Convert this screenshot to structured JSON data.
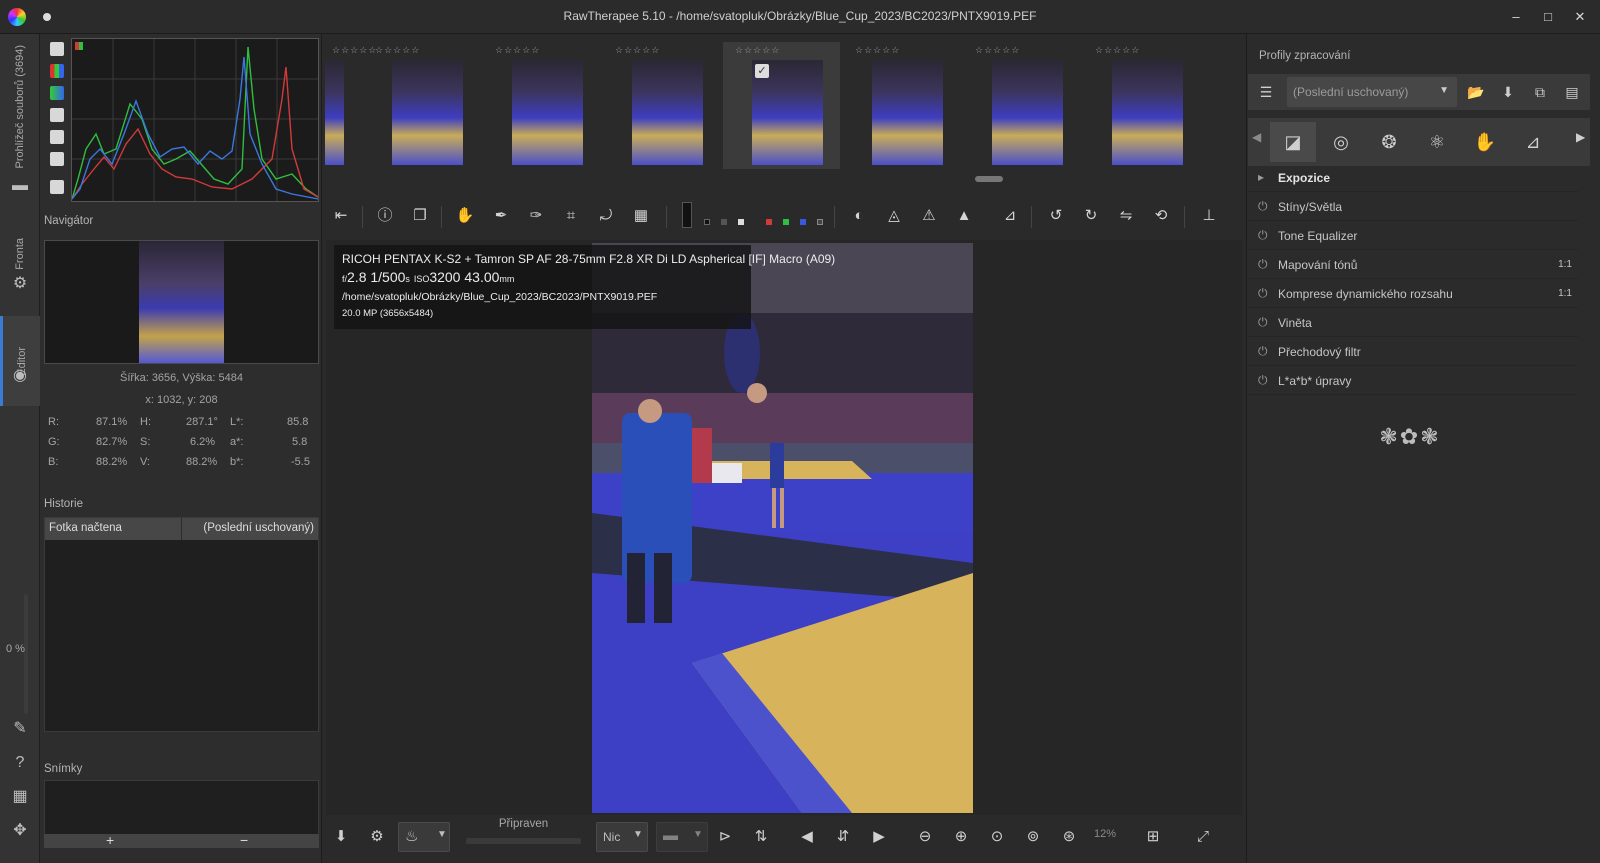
{
  "window": {
    "title": "RawTherapee 5.10 - /home/svatopluk/Obrázky/Blue_Cup_2023/BC2023/PNTX9019.PEF",
    "minimize": "–",
    "maximize": "□",
    "close": "✕"
  },
  "vertical_tabs": {
    "file_browser": "Prohlížeč souborů (3694)",
    "queue": "Fronta",
    "editor": "Editor",
    "zoom_percent": "0 %"
  },
  "left_panel": {
    "navigator_label": "Navigátor",
    "dims": "Šířka: 3656, Výška: 5484",
    "coords": "x: 1032, y: 208",
    "readouts": [
      {
        "k": "R:",
        "v": "87.1%",
        "k2": "H:",
        "v2": "287.1°",
        "k3": "L*:",
        "v3": "85.8"
      },
      {
        "k": "G:",
        "v": "82.7%",
        "k2": "S:",
        "v2": "6.2%",
        "k3": "a*:",
        "v3": "5.8"
      },
      {
        "k": "B:",
        "v": "88.2%",
        "k2": "V:",
        "v2": "88.2%",
        "k3": "b*:",
        "v3": "-5.5"
      }
    ],
    "history_label": "Historie",
    "history_item": "Fotka načtena",
    "history_item_value": "(Poslední uschovaný)",
    "snapshots_label": "Snímky",
    "snap_add": "+",
    "snap_remove": "−"
  },
  "filmstrip": {
    "stars": "☆☆☆☆☆"
  },
  "photo_info": {
    "camera": "RICOH PENTAX K-S2 + Tamron SP AF 28-75mm F2.8 XR Di LD Aspherical [IF] Macro (A09)",
    "aperture_prefix": "f/",
    "aperture": "2.8",
    "shutter": "1/500",
    "shutter_unit": "s",
    "iso_prefix": "ISO",
    "iso": "3200",
    "focal": "43.00",
    "focal_unit": "mm",
    "path": "/home/svatopluk/Obrázky/Blue_Cup_2023/BC2023/PNTX9019.PEF",
    "megapixels": "20.0 MP (3656x5484)"
  },
  "bottom_bar": {
    "status": "Připraven",
    "combo_value": "Nic",
    "zoom": "12%"
  },
  "right_panel": {
    "profiles_label": "Profily zpracování",
    "profile_value": "(Poslední uschovaný)",
    "tools": [
      {
        "label": "Expozice",
        "badge": ""
      },
      {
        "label": "Stíny/Světla",
        "badge": ""
      },
      {
        "label": "Tone Equalizer",
        "badge": ""
      },
      {
        "label": "Mapování tónů",
        "badge": "1:1"
      },
      {
        "label": "Komprese dynamického rozsahu",
        "badge": "1:1"
      },
      {
        "label": "Viněta",
        "badge": ""
      },
      {
        "label": "Přechodový filtr",
        "badge": ""
      },
      {
        "label": "L*a*b* úpravy",
        "badge": ""
      }
    ]
  },
  "colors": {
    "background": "#2a2a2a",
    "panel": "#2d2d2d",
    "histogram_red": "#d23a3a",
    "histogram_green": "#2fbf3f",
    "histogram_blue": "#3a78e0",
    "photo_blue": "#3b3bbf",
    "mat_yellow": "#d7b35c"
  }
}
